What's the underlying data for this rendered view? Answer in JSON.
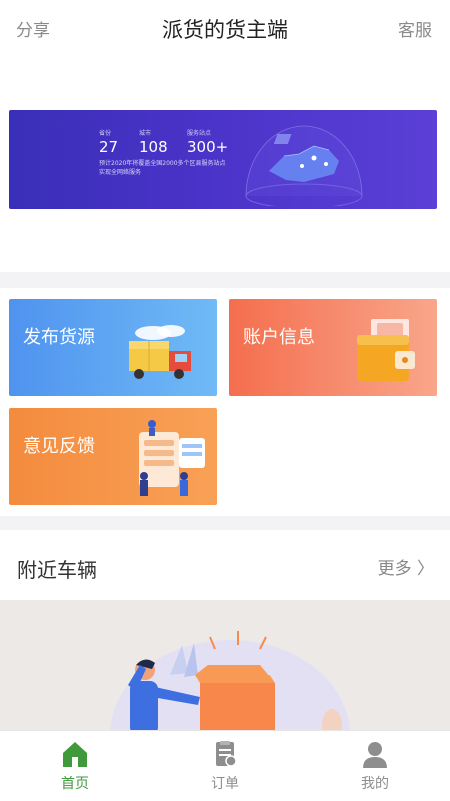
{
  "header": {
    "share": "分享",
    "title": "派货的货主端",
    "service": "客服"
  },
  "banner": {
    "stats": [
      {
        "label": "省份",
        "value": "27"
      },
      {
        "label": "城市",
        "value": "108"
      },
      {
        "label": "服务站点",
        "value": "300+"
      }
    ],
    "subtitle_line1": "预计2020年将覆盖全国2000多个区县服务站点",
    "subtitle_line2": "实现全网络服务"
  },
  "cards": [
    {
      "label": "发布货源",
      "color": "#5aa1f1"
    },
    {
      "label": "账户信息",
      "color": "#f6805f"
    },
    {
      "label": "意见反馈",
      "color": "#f6914a"
    }
  ],
  "nearby": {
    "title": "附近车辆",
    "more": "更多 〉"
  },
  "tabs": [
    {
      "label": "首页",
      "icon": "home-icon",
      "active": true
    },
    {
      "label": "订单",
      "icon": "order-icon",
      "active": false
    },
    {
      "label": "我的",
      "icon": "user-icon",
      "active": false
    }
  ],
  "colors": {
    "active": "#3e9a3a",
    "inactive": "#8e8e8e",
    "banner": "#4a33c8"
  }
}
